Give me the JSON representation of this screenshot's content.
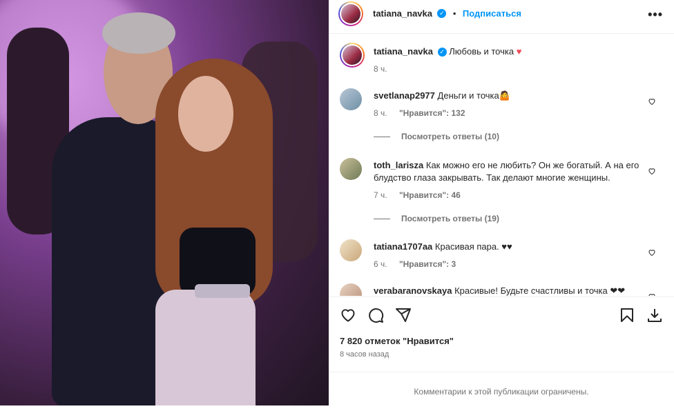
{
  "header": {
    "username": "tatiana_navka",
    "separator": "•",
    "follow_label": "Подписаться",
    "more_label": "•••"
  },
  "caption": {
    "username": "tatiana_navka",
    "text": "Любовь и точка",
    "heart": "♥",
    "time": "8 ч."
  },
  "comments": [
    {
      "username": "svetlanap2977",
      "text": "Деньги и точка🤷",
      "time": "8 ч.",
      "likes": "\"Нравится\": 132",
      "replies": "Посмотреть ответы (10)"
    },
    {
      "username": "toth_larisza",
      "text": "Как можно его не любить? Он же богатый. А на его блудство глаза закрывать. Так делают многие женщины.",
      "time": "7 ч.",
      "likes": "\"Нравится\": 46",
      "replies": "Посмотреть ответы (19)"
    },
    {
      "username": "tatiana1707aa",
      "text": "Красивая пара. ♥♥",
      "time": "6 ч.",
      "likes": "\"Нравится\": 3"
    },
    {
      "username": "verabaranovskaya",
      "text": "Красивые! Будьте счастливы и точка ❤❤",
      "time": "",
      "likes": ""
    }
  ],
  "footer": {
    "likes_count": "7 820 отметок \"Нравится\"",
    "posted_time": "8 часов назад",
    "restricted_text": "Комментарии к этой публикации ограничены."
  },
  "colors": {
    "accent": "#0095f6",
    "heart": "#ed4956",
    "text": "#262626",
    "muted": "#737373"
  },
  "icons": [
    "verified-icon",
    "more-icon",
    "heart-icon",
    "comment-icon",
    "share-icon",
    "bookmark-icon",
    "download-icon"
  ]
}
